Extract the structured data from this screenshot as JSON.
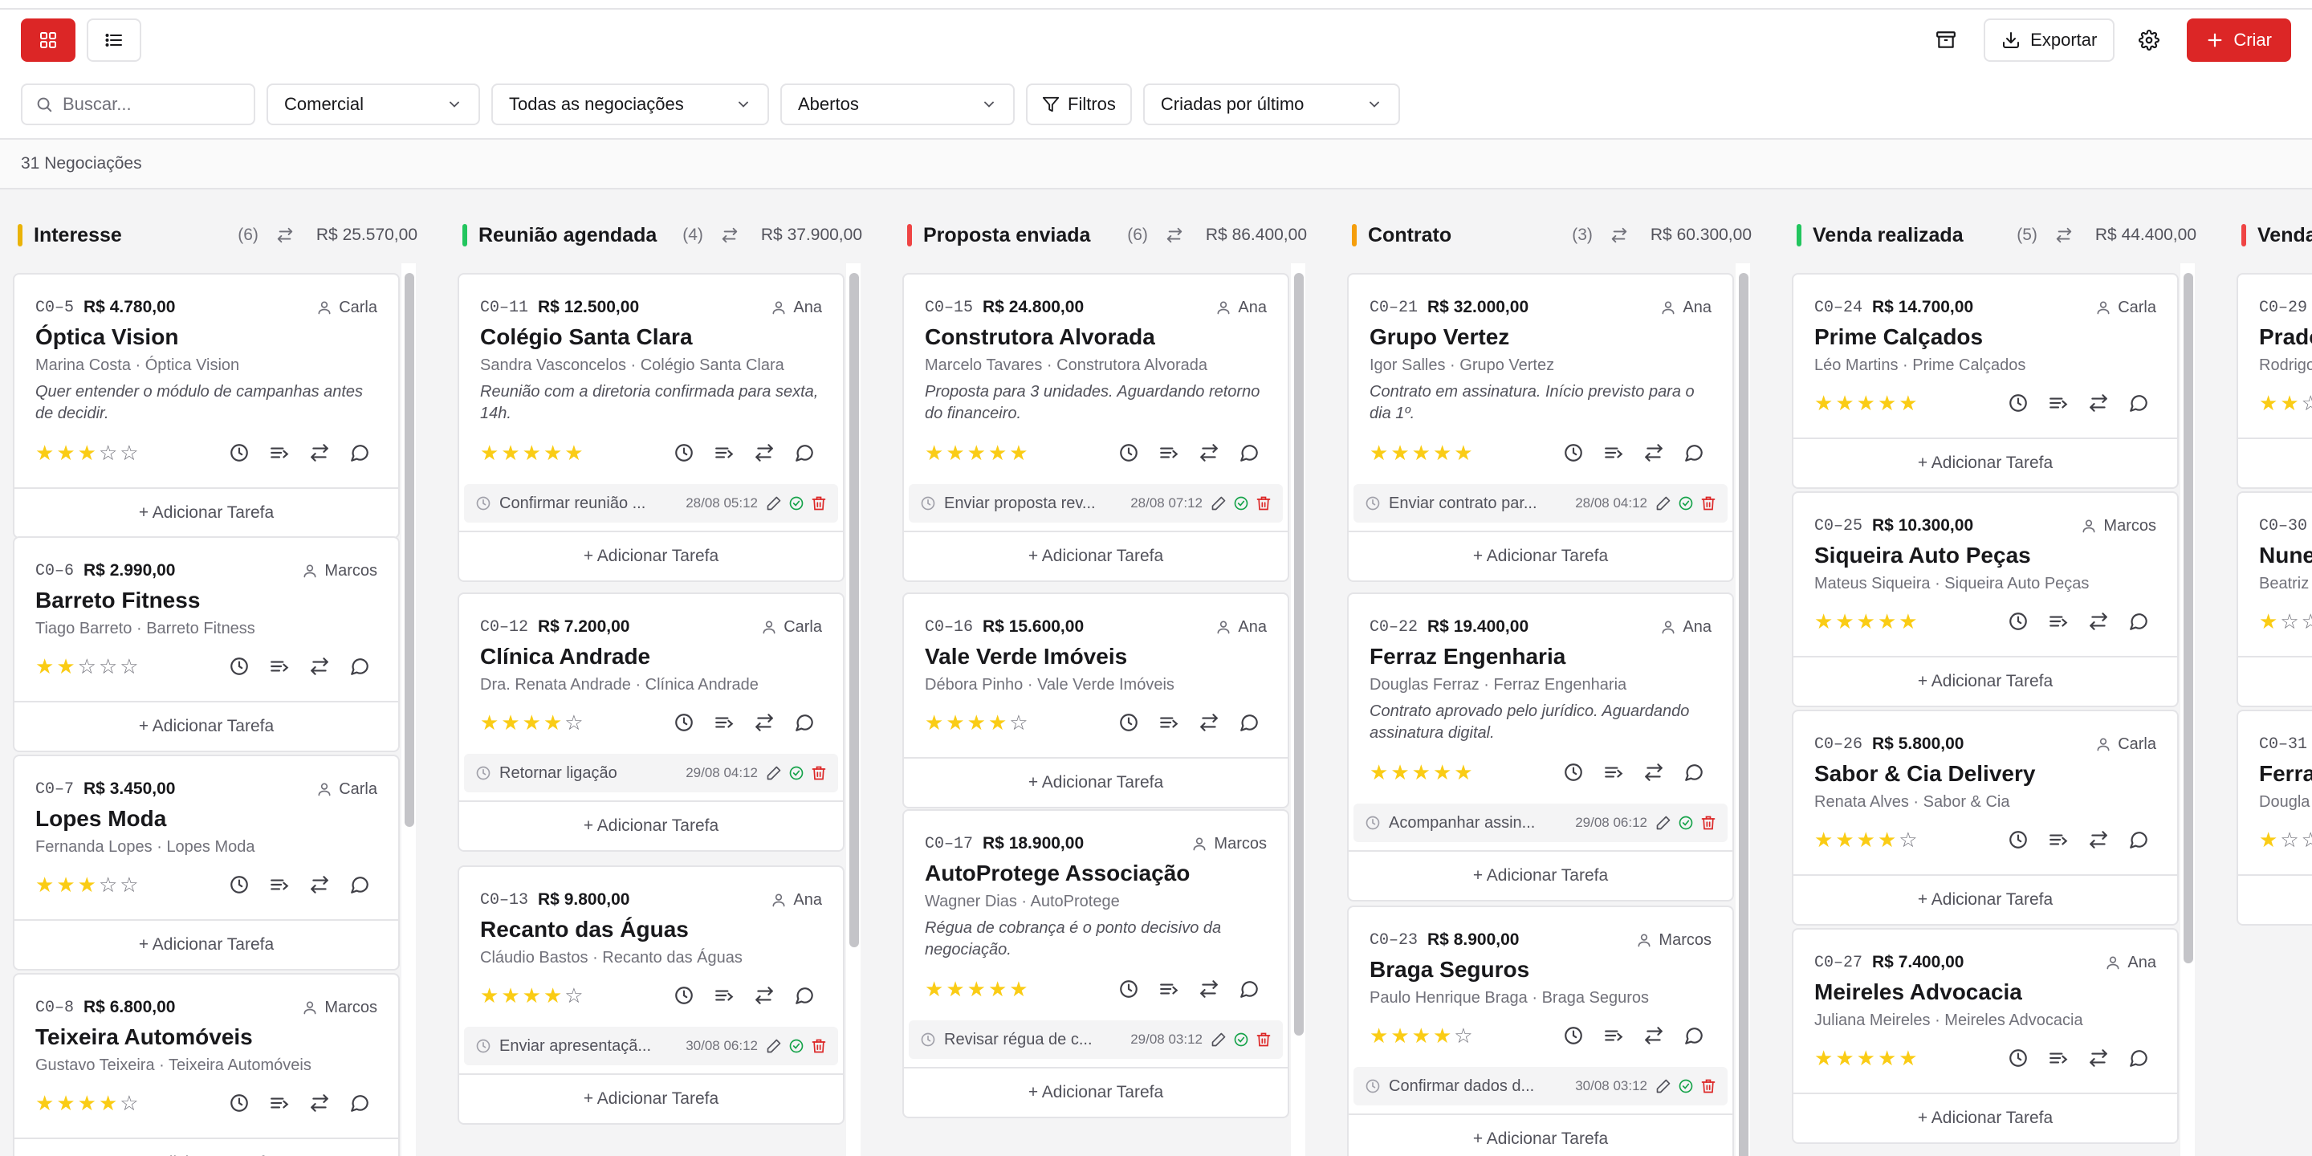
{
  "toolbar": {
    "export_label": "Exportar",
    "create_label": "Criar"
  },
  "filters": {
    "search_placeholder": "Buscar...",
    "department": "Comercial",
    "scope": "Todas as negociações",
    "status": "Abertos",
    "filters_label": "Filtros",
    "sort": "Criadas por último"
  },
  "summary": {
    "count_label": "31 Negociações"
  },
  "add_task_label": "+ Adicionar Tarefa",
  "colors": {
    "accent": "#dc2626",
    "star": "#facc15"
  },
  "columns": [
    {
      "title": "Interesse",
      "count": "(6)",
      "total": "R$ 25.570,00",
      "color": "#eab308",
      "cards": [
        {
          "code": "C0–5",
          "value": "R$ 4.780,00",
          "owner": "Carla",
          "name": "Óptica Vision",
          "contact": "Marina Costa · Óptica Vision",
          "note": "Quer entender o módulo de campanhas antes de decidir.",
          "rating": 3
        },
        {
          "code": "C0–6",
          "value": "R$ 2.990,00",
          "owner": "Marcos",
          "name": "Barreto Fitness",
          "contact": "Tiago Barreto · Barreto Fitness",
          "rating": 2
        },
        {
          "code": "C0–7",
          "value": "R$ 3.450,00",
          "owner": "Carla",
          "name": "Lopes Moda",
          "contact": "Fernanda Lopes · Lopes Moda",
          "rating": 3
        },
        {
          "code": "C0–8",
          "value": "R$ 6.800,00",
          "owner": "Marcos",
          "name": "Teixeira Automóveis",
          "contact": "Gustavo Teixeira · Teixeira Automóveis",
          "rating": 4
        }
      ]
    },
    {
      "title": "Reunião agendada",
      "count": "(4)",
      "total": "R$ 37.900,00",
      "color": "#22c55e",
      "cards": [
        {
          "code": "C0–11",
          "value": "R$ 12.500,00",
          "owner": "Ana",
          "name": "Colégio Santa Clara",
          "contact": "Sandra Vasconcelos · Colégio Santa Clara",
          "note": "Reunião com a diretoria confirmada para sexta, 14h.",
          "rating": 5,
          "task": {
            "text": "Confirmar reunião ...",
            "date": "28/08 05:12"
          }
        },
        {
          "code": "C0–12",
          "value": "R$ 7.200,00",
          "owner": "Carla",
          "name": "Clínica Andrade",
          "contact": "Dra. Renata Andrade · Clínica Andrade",
          "rating": 4,
          "task": {
            "text": "Retornar ligação",
            "date": "29/08 04:12"
          }
        },
        {
          "code": "C0–13",
          "value": "R$ 9.800,00",
          "owner": "Ana",
          "name": "Recanto das Águas",
          "contact": "Cláudio Bastos · Recanto das Águas",
          "rating": 4,
          "task": {
            "text": "Enviar apresentaçã...",
            "date": "30/08 06:12"
          }
        }
      ]
    },
    {
      "title": "Proposta enviada",
      "count": "(6)",
      "total": "R$ 86.400,00",
      "color": "#ef4444",
      "cards": [
        {
          "code": "C0–15",
          "value": "R$ 24.800,00",
          "owner": "Ana",
          "name": "Construtora Alvorada",
          "contact": "Marcelo Tavares · Construtora Alvorada",
          "note": "Proposta para 3 unidades. Aguardando retorno do financeiro.",
          "rating": 5,
          "task": {
            "text": "Enviar proposta rev...",
            "date": "28/08 07:12"
          }
        },
        {
          "code": "C0–16",
          "value": "R$ 15.600,00",
          "owner": "Ana",
          "name": "Vale Verde Imóveis",
          "contact": "Débora Pinho · Vale Verde Imóveis",
          "rating": 4
        },
        {
          "code": "C0–17",
          "value": "R$ 18.900,00",
          "owner": "Marcos",
          "name": "AutoProtege Associação",
          "contact": "Wagner Dias · AutoProtege",
          "note": "Régua de cobrança é o ponto decisivo da negociação.",
          "rating": 5,
          "task": {
            "text": "Revisar régua de c...",
            "date": "29/08 03:12"
          }
        }
      ]
    },
    {
      "title": "Contrato",
      "count": "(3)",
      "total": "R$ 60.300,00",
      "color": "#f59e0b",
      "cards": [
        {
          "code": "C0–21",
          "value": "R$ 32.000,00",
          "owner": "Ana",
          "name": "Grupo Vertez",
          "contact": "Igor Salles · Grupo Vertez",
          "note": "Contrato em assinatura. Início previsto para o dia 1º.",
          "rating": 5,
          "task": {
            "text": "Enviar contrato par...",
            "date": "28/08 04:12"
          }
        },
        {
          "code": "C0–22",
          "value": "R$ 19.400,00",
          "owner": "Ana",
          "name": "Ferraz Engenharia",
          "contact": "Douglas Ferraz · Ferraz Engenharia",
          "note": "Contrato aprovado pelo jurídico. Aguardando assinatura digital.",
          "rating": 5,
          "task": {
            "text": "Acompanhar assin...",
            "date": "29/08 06:12"
          }
        },
        {
          "code": "C0–23",
          "value": "R$ 8.900,00",
          "owner": "Marcos",
          "name": "Braga Seguros",
          "contact": "Paulo Henrique Braga · Braga Seguros",
          "rating": 4,
          "task": {
            "text": "Confirmar dados d...",
            "date": "30/08 03:12"
          }
        }
      ]
    },
    {
      "title": "Venda realizada",
      "count": "(5)",
      "total": "R$ 44.400,00",
      "color": "#22c55e",
      "cards": [
        {
          "code": "C0–24",
          "value": "R$ 14.700,00",
          "owner": "Carla",
          "name": "Prime Calçados",
          "contact": "Léo Martins · Prime Calçados",
          "rating": 5
        },
        {
          "code": "C0–25",
          "value": "R$ 10.300,00",
          "owner": "Marcos",
          "name": "Siqueira Auto Peças",
          "contact": "Mateus Siqueira · Siqueira Auto Peças",
          "rating": 5
        },
        {
          "code": "C0–26",
          "value": "R$ 5.800,00",
          "owner": "Carla",
          "name": "Sabor & Cia Delivery",
          "contact": "Renata Alves · Sabor & Cia",
          "rating": 4
        },
        {
          "code": "C0–27",
          "value": "R$ 7.400,00",
          "owner": "Ana",
          "name": "Meireles Advocacia",
          "contact": "Juliana Meireles · Meireles Advocacia",
          "rating": 5
        }
      ]
    },
    {
      "title": "Venda",
      "count": "",
      "total": "",
      "color": "#ef4444",
      "cards": [
        {
          "code": "C0–29",
          "value": "",
          "owner": "",
          "name": "Prado",
          "contact": "Rodrigo",
          "rating": 2
        },
        {
          "code": "C0–30",
          "value": "",
          "owner": "",
          "name": "Nune",
          "contact": "Beatriz",
          "rating": 1
        },
        {
          "code": "C0–31",
          "value": "",
          "owner": "",
          "name": "Ferra",
          "contact": "Dougla",
          "rating": 1
        }
      ]
    }
  ]
}
